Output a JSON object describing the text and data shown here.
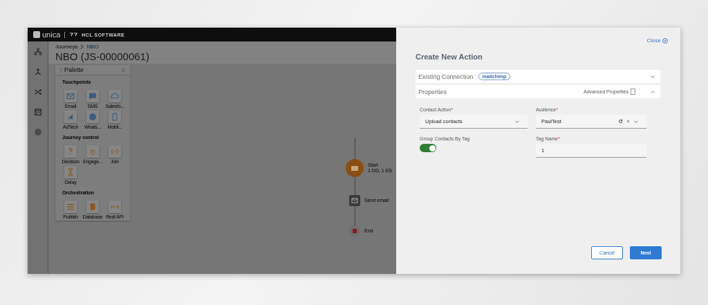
{
  "header": {
    "logo": "unica",
    "brand": "HCL SOFTWARE"
  },
  "rail": [
    {
      "kind": "hierarchy"
    },
    {
      "kind": "merge"
    },
    {
      "kind": "shuffle"
    },
    {
      "kind": "calendar"
    },
    {
      "kind": "gear"
    }
  ],
  "breadcrumb": [
    {
      "label": "Journeys",
      "selected": false
    },
    {
      "label": "NBO",
      "selected": true
    }
  ],
  "page_title": "NBO (JS-00000061)",
  "palette": {
    "title": "Palette",
    "sections": [
      {
        "title": "Touchpoints",
        "items": [
          {
            "label": "Email",
            "kind": "email"
          },
          {
            "label": "SMS",
            "kind": "sms"
          },
          {
            "label": "Salesfo...",
            "kind": "cloud"
          },
          {
            "label": "AdTech",
            "kind": "adtech"
          },
          {
            "label": "Whats...",
            "kind": "whatsapp"
          },
          {
            "label": "Mobil...",
            "kind": "mobile"
          }
        ]
      },
      {
        "title": "Journey control",
        "items": [
          {
            "label": "Decision",
            "kind": "decision"
          },
          {
            "label": "Engage...",
            "kind": "engage"
          },
          {
            "label": "Join",
            "kind": "join"
          },
          {
            "label": "Delay",
            "kind": "delay"
          }
        ]
      },
      {
        "title": "Orchestration",
        "items": [
          {
            "label": "Publish",
            "kind": "publish"
          },
          {
            "label": "Database",
            "kind": "database"
          },
          {
            "label": "Rest API",
            "kind": "restapi"
          }
        ]
      }
    ]
  },
  "flow": {
    "nodes": [
      {
        "kind": "start",
        "label": "Start",
        "sublabel": "1 DD, 1 ES"
      },
      {
        "kind": "email",
        "label": "Send email"
      },
      {
        "kind": "end",
        "label": "End"
      }
    ]
  },
  "dialog": {
    "close": "Close",
    "title": "Create New Action",
    "sections": [
      {
        "title": "Existing Connection",
        "tag": "mailchimp",
        "expanded": false
      },
      {
        "title": "Properties",
        "extra": "Advanced Properties",
        "extra_checked": false,
        "expanded": true
      }
    ],
    "fields": [
      {
        "kind": "select",
        "label": "Contact Action",
        "required_mark": "*",
        "value": "Upload contacts"
      },
      {
        "kind": "combo",
        "label": "Audience",
        "required_mark": "*",
        "value": "PaulTest"
      },
      {
        "kind": "toggle",
        "label": "Group Contacts By Tag",
        "on": true
      },
      {
        "kind": "text",
        "label": "Tag Name",
        "required_mark": "*",
        "value": "1"
      }
    ],
    "buttons": [
      {
        "label": "Cancel",
        "kind": "secondary"
      },
      {
        "label": "Next",
        "kind": "primary"
      }
    ]
  }
}
